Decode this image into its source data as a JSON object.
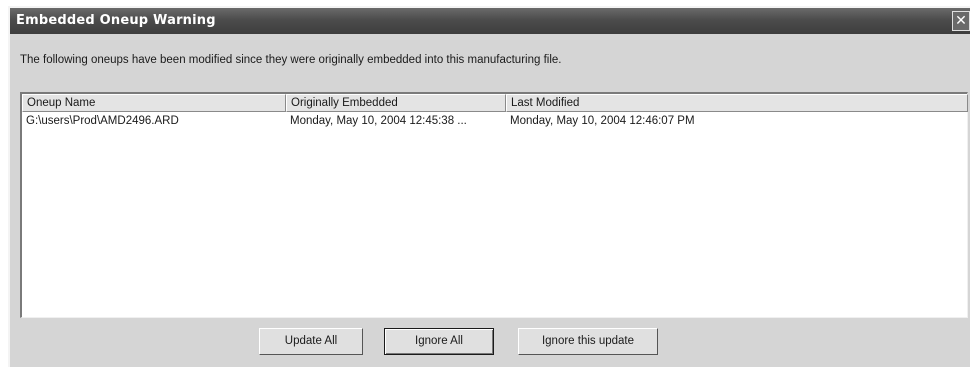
{
  "window": {
    "title": "Embedded Oneup Warning",
    "close_glyph": "✕",
    "close_icon": "close-icon"
  },
  "message": "The following oneups have been modified since they were originally embedded into this manufacturing file.",
  "list": {
    "columns": [
      "Oneup Name",
      "Originally Embedded",
      "Last Modified"
    ],
    "rows": [
      [
        "G:\\users\\Prod\\AMD2496.ARD",
        "Monday, May 10, 2004 12:45:38 ...",
        "Monday, May 10, 2004 12:46:07 PM"
      ]
    ]
  },
  "buttons": {
    "update_all": "Update All",
    "ignore_all": "Ignore All",
    "ignore_this": "Ignore this update"
  },
  "colors": {
    "titlebar": "#4c4c4c",
    "dialog_bg": "#d5d5d5",
    "list_bg": "#ffffff"
  }
}
